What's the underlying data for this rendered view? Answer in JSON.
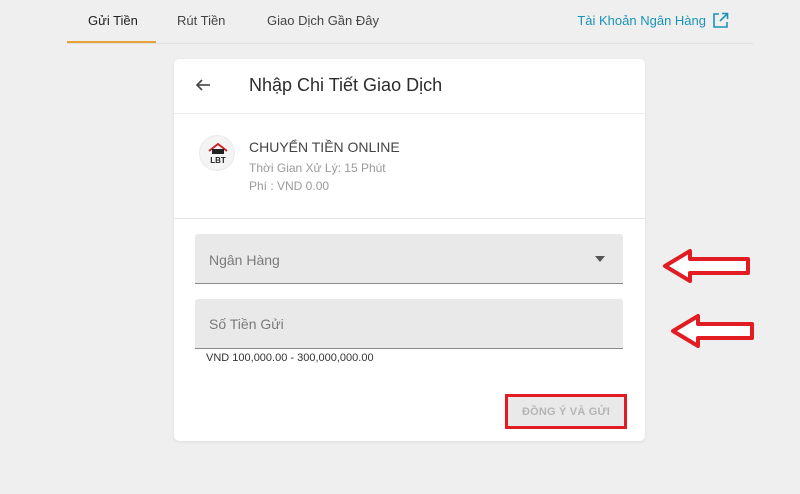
{
  "tabs": [
    {
      "label": "Gửi Tiền",
      "active": true
    },
    {
      "label": "Rút Tiền",
      "active": false
    },
    {
      "label": "Giao Dịch Gần Đây",
      "active": false
    }
  ],
  "bank_account_link": {
    "label": "Tài Khoản Ngân Hàng",
    "icon": "external-link-icon"
  },
  "card": {
    "title": "Nhập Chi Tiết Giao Dịch",
    "back_icon": "arrow-left-icon"
  },
  "method": {
    "logo_text": "LBT",
    "name": "CHUYỂN TIỀN ONLINE",
    "processing_time": "Thời Gian Xử Lý: 15 Phút",
    "fee": "Phí : VND 0.00"
  },
  "form": {
    "bank_label": "Ngân Hàng",
    "amount_placeholder": "Số Tiền Gửi",
    "amount_range": "VND 100,000.00 - 300,000,000.00",
    "submit_label": "ĐỒNG Ý VÀ GỬI"
  },
  "colors": {
    "accent_tab": "#e8a23a",
    "link": "#1a93b8",
    "annotation": "#e21c23"
  }
}
